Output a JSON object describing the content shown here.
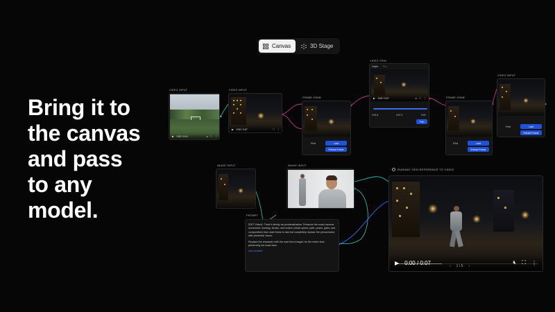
{
  "headline": [
    "Bring it to",
    "the canvas",
    "and pass",
    "to any",
    "model."
  ],
  "tabs": [
    {
      "label": "Canvas",
      "icon": "grid-icon",
      "active": true
    },
    {
      "label": "3D Stage",
      "icon": "cube-icon",
      "active": false
    }
  ],
  "nodes": {
    "video_input_1": {
      "title": "VIDEO INPUT",
      "time": "0:00 / 0:14"
    },
    "video_input_2": {
      "title": "VIDEO INPUT",
      "time": "0:00 / 0:07"
    },
    "frame_grab_1": {
      "title": "FRAME GRAB",
      "field_label": "First",
      "select_value": "Last",
      "button": "Extract Frame"
    },
    "video_trim": {
      "title": "VIDEO TRIM",
      "tab_a": "Graph",
      "tab_b": "Trim",
      "time": "0:00 / 0:07",
      "start": "0:01.6",
      "mid": "0:07.4",
      "end": "0:00",
      "button": "Trim"
    },
    "frame_grab_2": {
      "title": "FRAME GRAB",
      "field_label": "First",
      "select_value": "Last",
      "button": "Extract Frame"
    },
    "video_input_3": {
      "title": "VIDEO INPUT",
      "field_label": "First",
      "select_value": "Last",
      "button": "Extract Frame"
    },
    "image_input_1": {
      "title": "IMAGE INPUT"
    },
    "image_input_2": {
      "title": "IMAGE INPUT"
    }
  },
  "prompt": {
    "title": "PROMPT",
    "paragraph1": "EDIT Video1: Treat it strictly as previsualization. Preserve the exact camera movement, framing, terrain, and motion (tread speed, path, poses, gaits, and composition) from start frame to last but completely replace the person/actor with photoreal Jason.",
    "paragraph2": "Replace the character with the man from Image1 for the entire shot, preserving his exact face.",
    "link": "Add variable"
  },
  "output": {
    "title": "RUNWAY GEN REFERENCE TO VIDEO",
    "time": "0:00 / 0:07",
    "progress": 0.33,
    "page": "1 / 5"
  },
  "colors": {
    "accent": "#1f52d8",
    "link_teal": "#2bb9a7",
    "link_magenta": "#c0398f",
    "link_blue": "#3a6df0"
  }
}
